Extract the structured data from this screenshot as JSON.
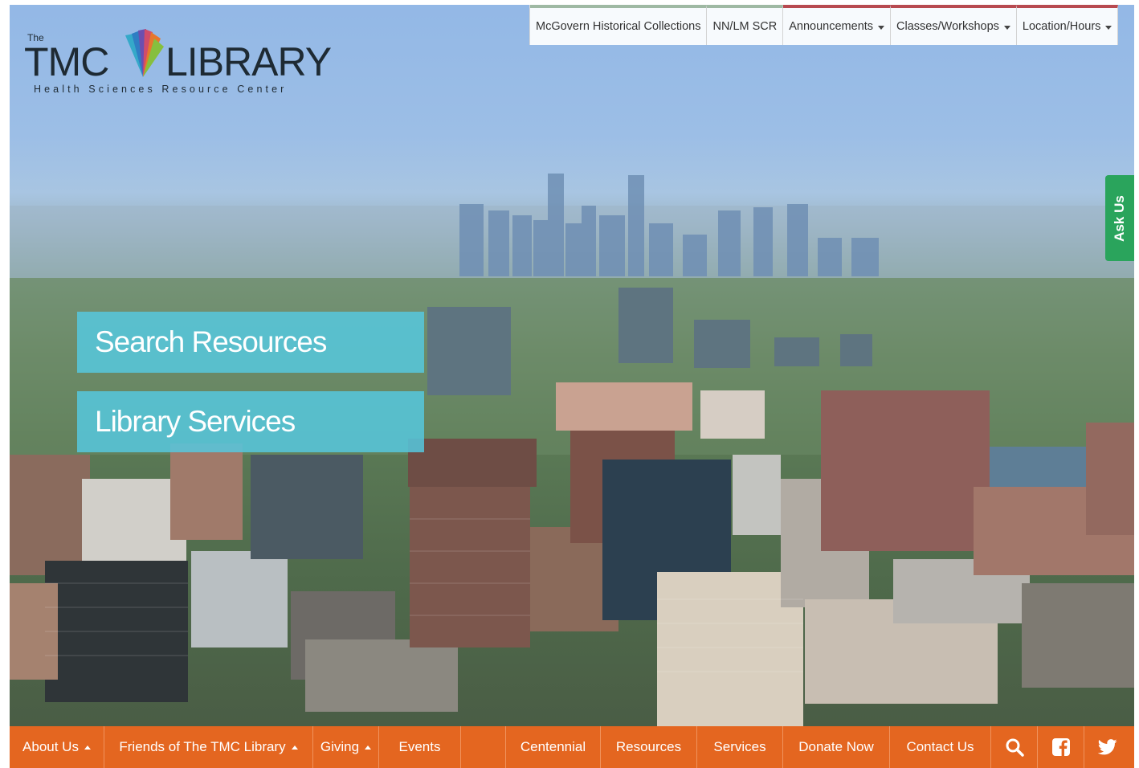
{
  "logo": {
    "the": "The",
    "tmc": "TMC",
    "library": "LIBRARY",
    "tagline": "Health Sciences Resource Center"
  },
  "top_nav": [
    {
      "label": "McGovern Historical Collections",
      "dropdown": false
    },
    {
      "label": "NN/LM SCR",
      "dropdown": false
    },
    {
      "label": "Announcements",
      "dropdown": true
    },
    {
      "label": "Classes/Workshops",
      "dropdown": true
    },
    {
      "label": "Location/Hours",
      "dropdown": true
    }
  ],
  "ask_us": "Ask Us",
  "hero": {
    "search_resources": "Search Resources",
    "library_services": "Library Services"
  },
  "bottom_nav": [
    {
      "label": "About Us",
      "dropdown": true
    },
    {
      "label": "Friends of The TMC Library",
      "dropdown": true
    },
    {
      "label": "Giving",
      "dropdown": true
    },
    {
      "label": "Events",
      "dropdown": false
    },
    {
      "label": "",
      "dropdown": false
    },
    {
      "label": "Centennial",
      "dropdown": false
    },
    {
      "label": "Resources",
      "dropdown": false
    },
    {
      "label": "Services",
      "dropdown": false
    },
    {
      "label": "Donate Now",
      "dropdown": false
    },
    {
      "label": "Contact Us",
      "dropdown": false
    }
  ],
  "bottom_icons": [
    "search-icon",
    "facebook-icon",
    "twitter-icon"
  ],
  "colors": {
    "nav_orange": "#e46620",
    "cta_teal": "#56c8de",
    "ask_us_green": "#2aa45c",
    "text_dark": "#1e2a33"
  }
}
